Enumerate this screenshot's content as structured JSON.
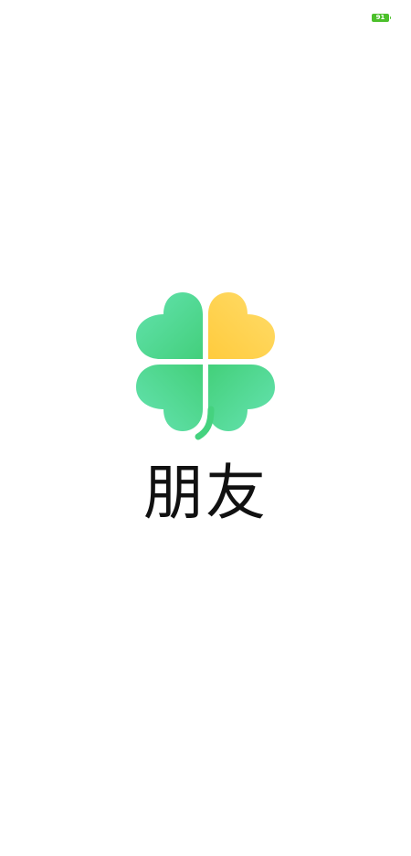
{
  "status_bar": {
    "battery_level": "91",
    "battery_color": "#4cc02b"
  },
  "splash": {
    "logo_icon": "four-leaf-clover-icon",
    "app_name": "朋友",
    "colors": {
      "green": "#45d27f",
      "green_light": "#5ee3a6",
      "yellow": "#ffd54a",
      "yellow_light": "#ffe066"
    }
  }
}
